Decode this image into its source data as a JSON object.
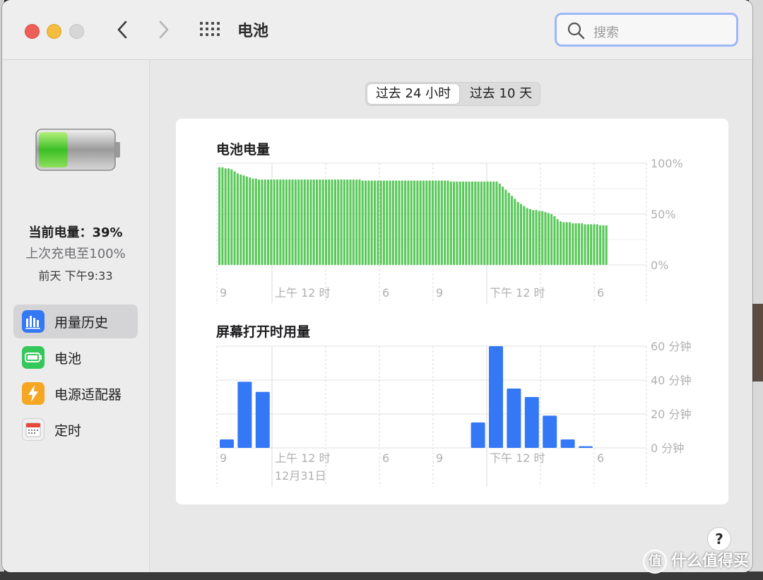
{
  "window": {
    "title": "电池"
  },
  "search": {
    "placeholder": "搜索"
  },
  "sidebar": {
    "status_main": "当前电量：39%",
    "status_sub": "上次充电至100%",
    "status_date": "前天 下午9:33",
    "battery_level": 0.39,
    "items": [
      {
        "label": "用量历史",
        "icon": "bar-chart-icon",
        "color": "#3478f6",
        "active": true
      },
      {
        "label": "电池",
        "icon": "battery-icon",
        "color": "#34c759",
        "active": false
      },
      {
        "label": "电源适配器",
        "icon": "lightning-icon",
        "color": "#f5a623",
        "active": false
      },
      {
        "label": "定时",
        "icon": "calendar-icon",
        "color": "#e0e0e0",
        "active": false
      }
    ]
  },
  "segment": {
    "option_24h": "过去 24 小时",
    "option_10d": "过去 10 天",
    "selected": "option_24h"
  },
  "charts": {
    "battery_title": "电池电量",
    "screen_title": "屏幕打开时用量"
  },
  "chart_data": [
    {
      "type": "bar",
      "title": "电池电量",
      "y_tick_labels": [
        "100%",
        "50%",
        "0%"
      ],
      "ylim": [
        0,
        100
      ],
      "x_tick_labels": [
        "9",
        "上午 12 时",
        "6",
        "9",
        "下午 12 时",
        "6"
      ],
      "color": "#5ac85a",
      "values": [
        96,
        96,
        95,
        95,
        94,
        92,
        90,
        89,
        88,
        87,
        86,
        85,
        85,
        84,
        84,
        84,
        84,
        84,
        84,
        84,
        84,
        84,
        84,
        84,
        84,
        84,
        84,
        84,
        84,
        84,
        84,
        84,
        84,
        84,
        84,
        84,
        84,
        84,
        84,
        84,
        84,
        84,
        84,
        84,
        84,
        84,
        84,
        83,
        83,
        83,
        83,
        83,
        83,
        83,
        83,
        83,
        83,
        83,
        83,
        83,
        83,
        83,
        83,
        83,
        83,
        83,
        83,
        83,
        83,
        83,
        83,
        83,
        83,
        83,
        83,
        83,
        82,
        82,
        82,
        82,
        82,
        82,
        82,
        82,
        82,
        82,
        82,
        82,
        82,
        82,
        82,
        82,
        80,
        77,
        74,
        71,
        68,
        65,
        62,
        60,
        58,
        56,
        55,
        54,
        54,
        53,
        53,
        52,
        51,
        50,
        48,
        45,
        43,
        42,
        42,
        42,
        41,
        41,
        41,
        41,
        40,
        40,
        40,
        40,
        40,
        39,
        39,
        39
      ]
    },
    {
      "type": "bar",
      "title": "屏幕打开时用量",
      "y_tick_labels": [
        "60 分钟",
        "40 分钟",
        "20 分钟",
        "0 分钟"
      ],
      "ylim": [
        0,
        60
      ],
      "x_tick_labels": [
        "9",
        "上午 12 时",
        "6",
        "9",
        "下午 12 时",
        "6"
      ],
      "x_sublabel": "12月31日",
      "color": "#3478f6",
      "values": [
        5,
        39,
        33,
        0,
        0,
        0,
        0,
        0,
        0,
        0,
        0,
        0,
        0,
        0,
        15,
        60,
        35,
        30,
        19,
        5,
        1,
        0,
        0,
        0
      ]
    }
  ],
  "help": {
    "label": "?"
  },
  "watermark": {
    "circle": "值",
    "text": "什么值得买"
  }
}
